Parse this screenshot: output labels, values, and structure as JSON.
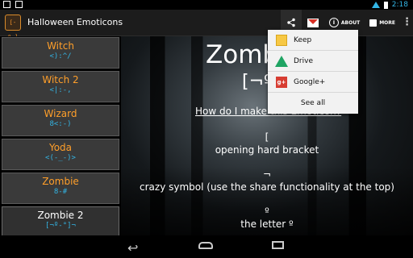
{
  "status_bar": {
    "time": "2:18",
    "icons": [
      "screenshot-icon",
      "android-debug-icon",
      "wifi-icon",
      "battery-icon"
    ]
  },
  "action_bar": {
    "app_icon_text": "[-º-]",
    "title": "Halloween Emoticons",
    "share_icon": "share-icon",
    "gmail_icon": "gmail-icon",
    "about_label": "ABOUT",
    "more_label": "MORE",
    "overflow_icon": "overflow-menu-icon"
  },
  "emoticon_list": [
    {
      "name": "Witch",
      "emoticon": "<):^/"
    },
    {
      "name": "Witch 2",
      "emoticon": "<|:-,"
    },
    {
      "name": "Wizard",
      "emoticon": "8<:-)"
    },
    {
      "name": "Yoda",
      "emoticon": "<(-_-)>"
    },
    {
      "name": "Zombie",
      "emoticon": "8-#"
    },
    {
      "name": "Zombie 2",
      "emoticon": "[¬º-°]¬"
    }
  ],
  "detail": {
    "title": "Zombie",
    "emoticon": "[¬º-°]¬",
    "how_to_link": "How do I make this Emoticon?",
    "characters": [
      {
        "char": "[",
        "description": "opening hard bracket"
      },
      {
        "char": "¬",
        "description": "crazy symbol (use the share functionality at the top)"
      },
      {
        "char": "º",
        "description": "the letter º"
      }
    ]
  },
  "share_menu": {
    "items": [
      {
        "label": "Keep",
        "icon": "keep-icon"
      },
      {
        "label": "Drive",
        "icon": "drive-icon"
      },
      {
        "label": "Google+",
        "icon": "google-plus-icon"
      }
    ],
    "see_all_label": "See all"
  },
  "nav_bar": {
    "icons": [
      "back-icon",
      "home-icon",
      "recent-apps-icon"
    ]
  },
  "colors": {
    "accent_orange": "#ff9f2a",
    "accent_blue": "#33b5e5",
    "list_item_bg": "#3a3a3a",
    "action_bar_bg": "#1c1c1c"
  }
}
